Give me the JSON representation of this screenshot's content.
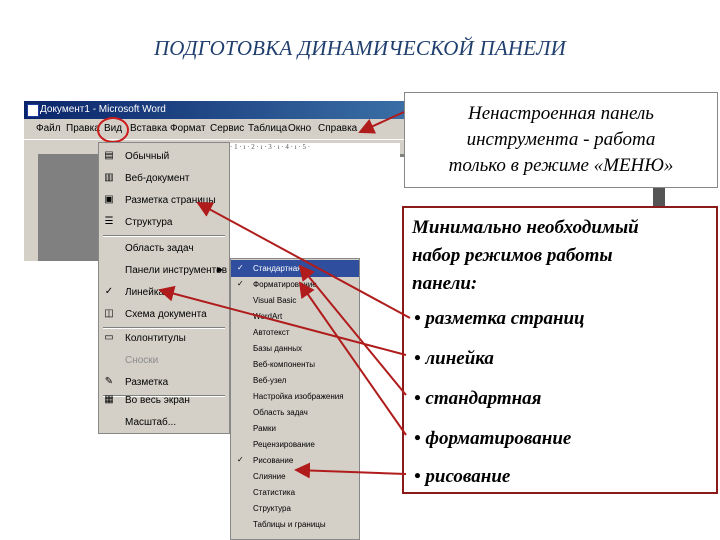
{
  "slide": {
    "title": "ПОДГОТОВКА ДИНАМИЧЕСКОЙ ПАНЕЛИ"
  },
  "word": {
    "window_title": "Документ1 - Microsoft Word",
    "menu": [
      "Файл",
      "Правка",
      "Вид",
      "Вставка",
      "Формат",
      "Сервис",
      "Таблица",
      "Окно",
      "Справка"
    ],
    "ruler_text": "· 1 · ı · 2 · ı · 3 · ı · 4 · ı · 5 ·"
  },
  "view_menu": [
    {
      "label": "Обычный",
      "icon": "normal-view-icon",
      "disabled": false
    },
    {
      "label": "Веб-документ",
      "icon": "web-layout-icon",
      "disabled": false
    },
    {
      "label": "Разметка страницы",
      "icon": "print-layout-icon",
      "disabled": false
    },
    {
      "label": "Структура",
      "icon": "outline-view-icon",
      "disabled": false
    },
    {
      "label": "Область задач",
      "icon": "",
      "disabled": false
    },
    {
      "label": "Панели инструментов",
      "icon": "",
      "disabled": false,
      "submenu": true
    },
    {
      "label": "Линейка",
      "icon": "check-icon",
      "disabled": false
    },
    {
      "label": "Схема документа",
      "icon": "document-map-icon",
      "disabled": false
    },
    {
      "label": "Колонтитулы",
      "icon": "header-footer-icon",
      "disabled": false
    },
    {
      "label": "Сноски",
      "icon": "footnotes-icon",
      "disabled": true
    },
    {
      "label": "Разметка",
      "icon": "markup-icon",
      "disabled": false
    },
    {
      "label": "Во весь экран",
      "icon": "full-screen-icon",
      "disabled": false
    },
    {
      "label": "Масштаб...",
      "icon": "",
      "disabled": false
    }
  ],
  "toolbars_submenu": [
    {
      "label": "Стандартная",
      "checked": true,
      "highlighted": true
    },
    {
      "label": "Форматирование",
      "checked": true,
      "highlighted": false
    },
    {
      "label": "Visual Basic",
      "checked": false,
      "highlighted": false
    },
    {
      "label": "WordArt",
      "checked": false,
      "highlighted": false
    },
    {
      "label": "Автотекст",
      "checked": false,
      "highlighted": false
    },
    {
      "label": "Базы данных",
      "checked": false,
      "highlighted": false
    },
    {
      "label": "Веб-компоненты",
      "checked": false,
      "highlighted": false
    },
    {
      "label": "Веб-узел",
      "checked": false,
      "highlighted": false
    },
    {
      "label": "Настройка изображения",
      "checked": false,
      "highlighted": false
    },
    {
      "label": "Область задач",
      "checked": false,
      "highlighted": false
    },
    {
      "label": "Рамки",
      "checked": false,
      "highlighted": false
    },
    {
      "label": "Рецензирование",
      "checked": false,
      "highlighted": false
    },
    {
      "label": "Рисование",
      "checked": true,
      "highlighted": false
    },
    {
      "label": "Слияние",
      "checked": false,
      "highlighted": false
    },
    {
      "label": "Статистика",
      "checked": false,
      "highlighted": false
    },
    {
      "label": "Структура",
      "checked": false,
      "highlighted": false
    },
    {
      "label": "Таблицы и границы",
      "checked": false,
      "highlighted": false
    }
  ],
  "callout_top": {
    "lines": [
      "Ненастроенная панель",
      "инструмента - работа",
      "только в режиме «МЕНЮ»"
    ]
  },
  "callout_main": {
    "heading_lines": [
      "Минимально необходимый",
      "набор режимов работы",
      "панели:"
    ],
    "bullets": [
      "• разметка страниц",
      "• линейка",
      "• стандартная",
      "• форматирование",
      "• рисование"
    ]
  },
  "colors": {
    "title": "#1f3f6e",
    "arrow": "#b01c1c",
    "highlight": "#2f4f9e",
    "menu_bg": "#d4d0c8"
  }
}
